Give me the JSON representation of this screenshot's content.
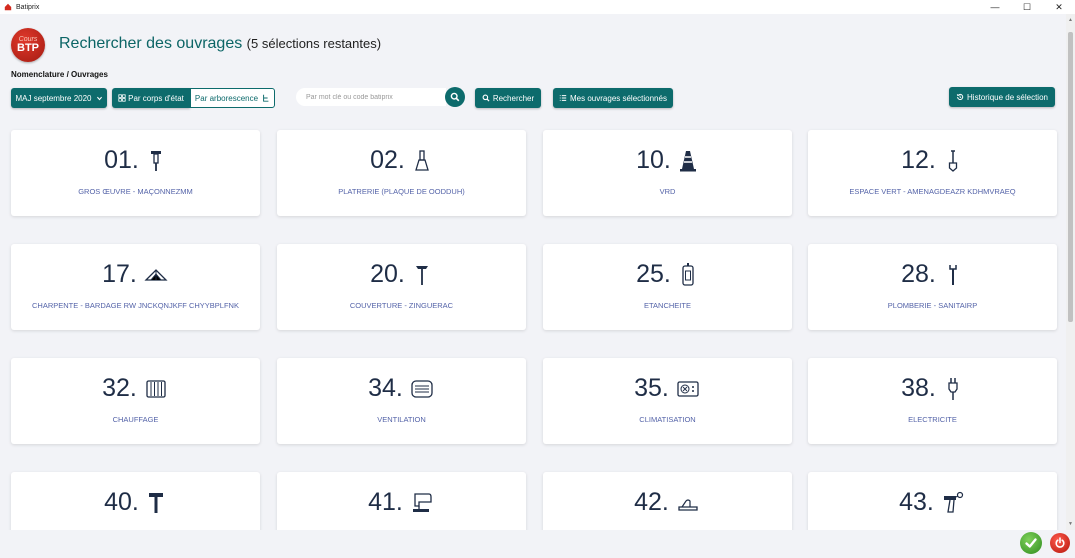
{
  "window": {
    "title": "Batiprix",
    "minimize": "—",
    "maximize": "☐",
    "close": "✕"
  },
  "logo": {
    "line1": "Cours",
    "line2": "BTP"
  },
  "header": {
    "title": "Rechercher des ouvrages",
    "subtitle": "(5 sélections restantes)"
  },
  "breadcrumb": "Nomenclature / Ouvrages",
  "toolbar": {
    "version_label": "MAJ septembre 2020",
    "by_trade_label": "Par corps d'état",
    "by_tree_label": "Par arborescence",
    "search_placeholder": "Par mot clé ou code batiprix",
    "search_value": "",
    "search_label": "Rechercher",
    "selected_label": "Mes ouvrages sélectionnés",
    "history_label": "Historique de sélection"
  },
  "cards": [
    {
      "number": "01.",
      "label": "GROS ŒUVRE - MAÇONNEZMM",
      "icon": "jackhammer-icon"
    },
    {
      "number": "02.",
      "label": "PLATRERIE (PLAQUE DE OODDUH)",
      "icon": "putty-knife-icon"
    },
    {
      "number": "10.",
      "label": "VRD",
      "icon": "traffic-cone-icon"
    },
    {
      "number": "12.",
      "label": "ESPACE VERT - AMENAGDEAZR KDHMVRAEQ",
      "icon": "shovel-icon"
    },
    {
      "number": "17.",
      "label": "CHARPENTE - BARDAGE RW JNCKQNJKFF CHYYBPLFNK",
      "icon": "roof-truss-icon"
    },
    {
      "number": "20.",
      "label": "COUVERTURE - ZINGUERAC",
      "icon": "roofing-hammer-icon"
    },
    {
      "number": "25.",
      "label": "ETANCHEITE",
      "icon": "sealant-cartridge-icon"
    },
    {
      "number": "28.",
      "label": "PLOMBERIE - SANITAIRP",
      "icon": "wrench-icon"
    },
    {
      "number": "32.",
      "label": "CHAUFFAGE",
      "icon": "radiator-icon"
    },
    {
      "number": "34.",
      "label": "VENTILATION",
      "icon": "ventilation-icon"
    },
    {
      "number": "35.",
      "label": "CLIMATISATION",
      "icon": "air-conditioner-icon"
    },
    {
      "number": "38.",
      "label": "ELECTRICITE",
      "icon": "plug-icon"
    },
    {
      "number": "40.",
      "label": "",
      "icon": "hammer-icon"
    },
    {
      "number": "41.",
      "label": "",
      "icon": "jigsaw-icon"
    },
    {
      "number": "42.",
      "label": "",
      "icon": "plane-tool-icon"
    },
    {
      "number": "43.",
      "label": "",
      "icon": "spray-gun-icon"
    }
  ],
  "footer": {
    "ok": "ok-icon",
    "quit": "quit-icon"
  },
  "colors": {
    "teal": "#0d6b6c",
    "number": "#1f2d46",
    "label": "#5463a8",
    "background": "#f2f3f7"
  }
}
